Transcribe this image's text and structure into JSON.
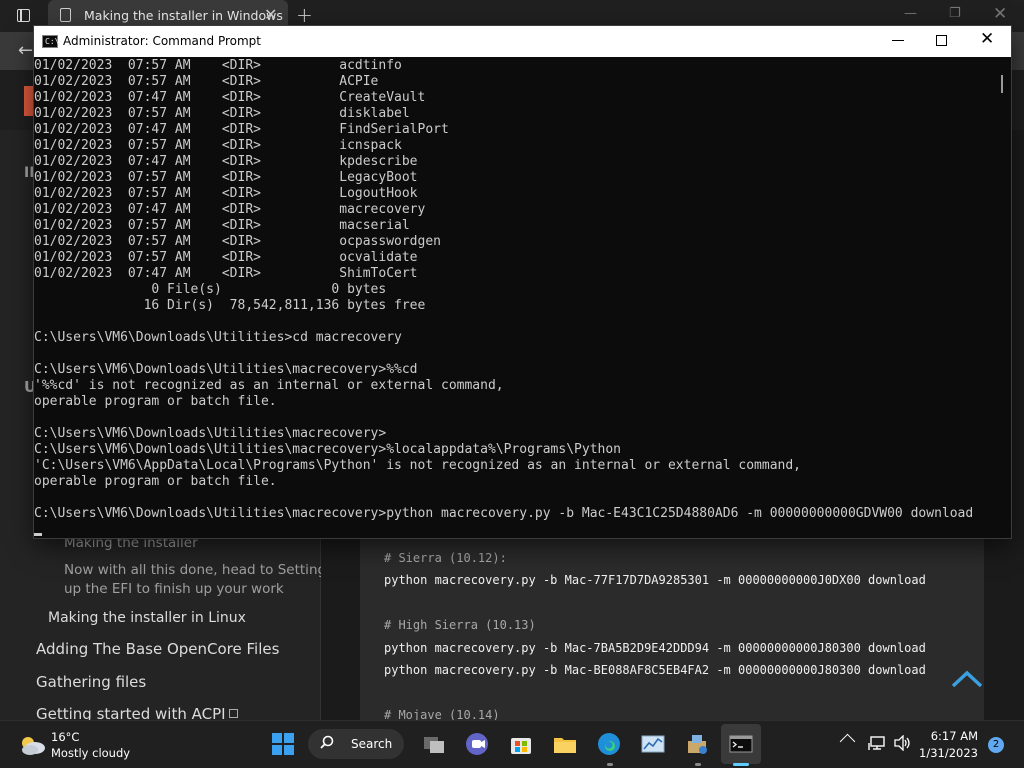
{
  "browser": {
    "tab_title": "Making the installer in Windows",
    "tab_close": "✕",
    "new_tab": "+",
    "window_controls": {
      "minimize": "—",
      "restore": "❐",
      "close": "✕"
    },
    "back": "←"
  },
  "sidebar": {
    "fragment_1": "II",
    "fragment_2": "U",
    "items": [
      {
        "label": "Making the installer",
        "level": 3
      },
      {
        "label": "Now with all this done, head to Setting",
        "level": 3
      },
      {
        "label": "up the EFI to finish up your work",
        "level": 3
      },
      {
        "label": "Making the installer in Linux",
        "level": 2
      },
      {
        "label": "Adding The Base OpenCore Files",
        "level": 1
      },
      {
        "label": "Gathering files",
        "level": 1
      },
      {
        "label": "Getting started with ACPI",
        "level": 1
      }
    ]
  },
  "code_block": {
    "lines": [
      {
        "text": "# Sierra (10.12):",
        "kind": "comment"
      },
      {
        "text": "python macrecovery.py -b Mac-77F17D7DA9285301 -m 00000000000J0DX00 download",
        "kind": "code"
      },
      {
        "text": "",
        "kind": "blank"
      },
      {
        "text": "# High Sierra (10.13)",
        "kind": "comment"
      },
      {
        "text": "python macrecovery.py -b Mac-7BA5B2D9E42DDD94 -m 00000000000J80300 download",
        "kind": "code"
      },
      {
        "text": "python macrecovery.py -b Mac-BE088AF8C5EB4FA2 -m 00000000000J80300 download",
        "kind": "code"
      },
      {
        "text": "",
        "kind": "blank"
      },
      {
        "text": "# Mojave (10.14)",
        "kind": "comment"
      }
    ]
  },
  "cmd": {
    "title": "Administrator: Command Prompt",
    "icon_text": "C:\\",
    "lines": [
      "01/02/2023  07:57 AM    <DIR>          acdtinfo",
      "01/02/2023  07:57 AM    <DIR>          ACPIe",
      "01/02/2023  07:47 AM    <DIR>          CreateVault",
      "01/02/2023  07:57 AM    <DIR>          disklabel",
      "01/02/2023  07:47 AM    <DIR>          FindSerialPort",
      "01/02/2023  07:57 AM    <DIR>          icnspack",
      "01/02/2023  07:47 AM    <DIR>          kpdescribe",
      "01/02/2023  07:57 AM    <DIR>          LegacyBoot",
      "01/02/2023  07:57 AM    <DIR>          LogoutHook",
      "01/02/2023  07:47 AM    <DIR>          macrecovery",
      "01/02/2023  07:57 AM    <DIR>          macserial",
      "01/02/2023  07:57 AM    <DIR>          ocpasswordgen",
      "01/02/2023  07:57 AM    <DIR>          ocvalidate",
      "01/02/2023  07:47 AM    <DIR>          ShimToCert",
      "               0 File(s)              0 bytes",
      "              16 Dir(s)  78,542,811,136 bytes free",
      "",
      "C:\\Users\\VM6\\Downloads\\Utilities>cd macrecovery",
      "",
      "C:\\Users\\VM6\\Downloads\\Utilities\\macrecovery>%%cd",
      "'%%cd' is not recognized as an internal or external command,",
      "operable program or batch file.",
      "",
      "C:\\Users\\VM6\\Downloads\\Utilities\\macrecovery>",
      "C:\\Users\\VM6\\Downloads\\Utilities\\macrecovery>%localappdata%\\Programs\\Python",
      "'C:\\Users\\VM6\\AppData\\Local\\Programs\\Python' is not recognized as an internal or external command,",
      "operable program or batch file.",
      "",
      "C:\\Users\\VM6\\Downloads\\Utilities\\macrecovery>python macrecovery.py -b Mac-E43C1C25D4880AD6 -m 00000000000GDVW00 download"
    ]
  },
  "taskbar": {
    "weather": {
      "temp": "16°C",
      "condition": "Mostly cloudy"
    },
    "search_label": "Search",
    "time": "6:17 AM",
    "date": "1/31/2023",
    "notification_count": "2"
  }
}
